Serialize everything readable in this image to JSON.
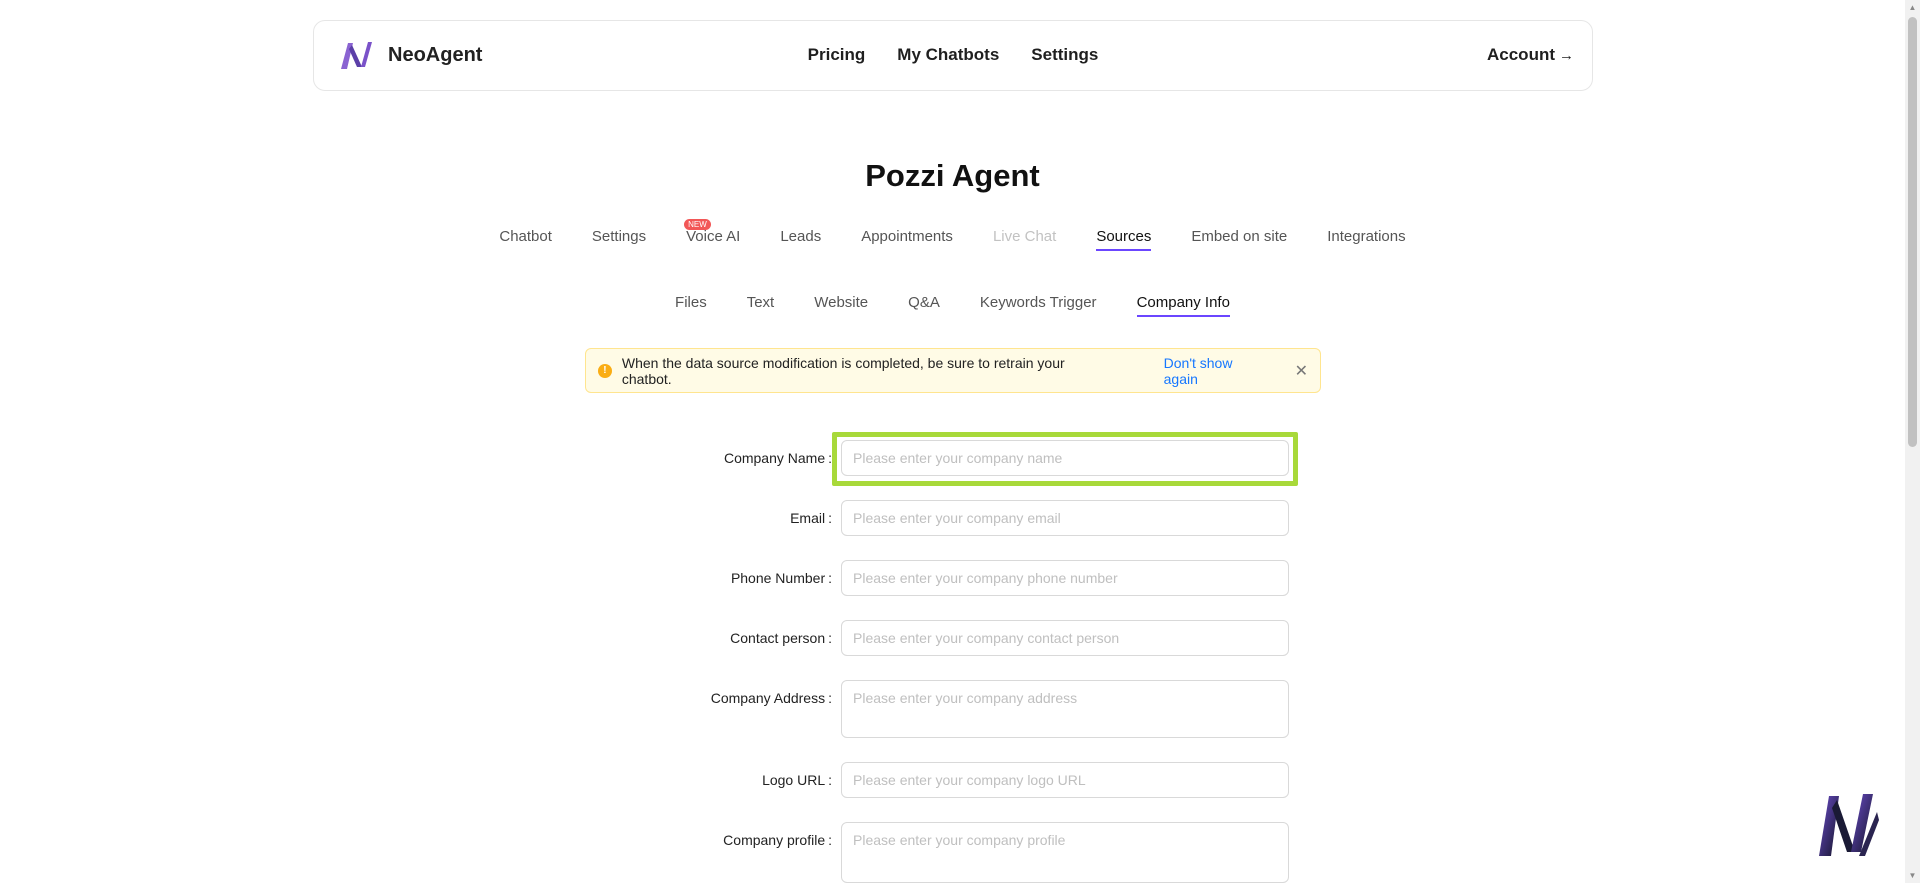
{
  "header": {
    "brand_name": "NeoAgent",
    "nav": [
      "Pricing",
      "My Chatbots",
      "Settings"
    ],
    "account_label": "Account",
    "account_arrow": "→"
  },
  "page_title": "Pozzi Agent",
  "main_tabs": {
    "items": [
      "Chatbot",
      "Settings",
      "Voice AI",
      "Leads",
      "Appointments",
      "Live Chat",
      "Sources",
      "Embed on site",
      "Integrations"
    ],
    "new_badge": "NEW",
    "active": "Sources"
  },
  "sub_tabs": {
    "items": [
      "Files",
      "Text",
      "Website",
      "Q&A",
      "Keywords Trigger",
      "Company Info"
    ],
    "active": "Company Info"
  },
  "alert": {
    "text": "When the data source modification is completed, be sure to retrain your chatbot.",
    "link": "Don't show again",
    "icon": "!",
    "close": "✕"
  },
  "form": {
    "fields": [
      {
        "label": "Company Name",
        "placeholder": "Please enter your company name",
        "value": ""
      },
      {
        "label": "Email",
        "placeholder": "Please enter your company email",
        "value": ""
      },
      {
        "label": "Phone Number",
        "placeholder": "Please enter your company phone number",
        "value": ""
      },
      {
        "label": "Contact person",
        "placeholder": "Please enter your company contact person",
        "value": ""
      },
      {
        "label": "Company Address",
        "placeholder": "Please enter your company address",
        "value": ""
      },
      {
        "label": "Logo URL",
        "placeholder": "Please enter your company logo URL",
        "value": ""
      },
      {
        "label": "Company profile",
        "placeholder": "Please enter your company profile",
        "value": ""
      }
    ],
    "colon": ":"
  },
  "colors": {
    "accent": "#6b46ff",
    "highlight": "#a8d93a",
    "link": "#1677ff",
    "warning": "#faad14"
  },
  "icons": {
    "brand": "neoagent-logo-icon",
    "alert": "warning-icon",
    "close": "close-icon",
    "widget": "chat-widget-icon"
  }
}
